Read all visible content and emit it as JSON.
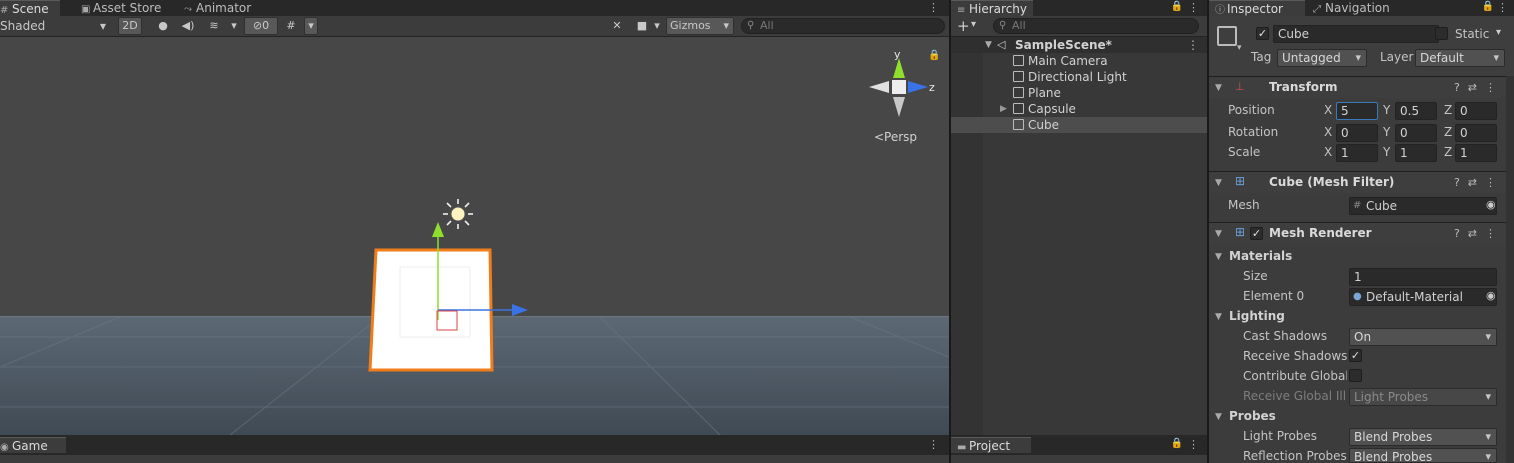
{
  "scene_panel": {
    "tabs": [
      {
        "label": "Scene",
        "icon": "grid-icon"
      },
      {
        "label": "Asset Store",
        "icon": "bag-icon"
      },
      {
        "label": "Animator",
        "icon": "animator-icon"
      }
    ],
    "toolbar": {
      "shading_mode": "Shaded",
      "mode_2d": "2D",
      "hidden_count": "0",
      "gizmos": "Gizmos",
      "search_placeholder": "All"
    },
    "viewport": {
      "persp_label": "Persp",
      "axis_y": "y",
      "axis_z": "z"
    }
  },
  "hierarchy": {
    "tab_label": "Hierarchy",
    "search_placeholder": "All",
    "scene_name": "SampleScene*",
    "items": [
      "Main Camera",
      "Directional Light",
      "Plane",
      "Capsule",
      "Cube"
    ],
    "selected": "Cube"
  },
  "inspector": {
    "tabs": [
      {
        "label": "Inspector",
        "icon": "info-icon"
      },
      {
        "label": "Navigation",
        "icon": "navigation-icon"
      }
    ],
    "object_name": "Cube",
    "static_label": "Static",
    "tag_label": "Tag",
    "tag_value": "Untagged",
    "layer_label": "Layer",
    "layer_value": "Default",
    "transform": {
      "title": "Transform",
      "position_label": "Position",
      "rotation_label": "Rotation",
      "scale_label": "Scale",
      "position": {
        "x": "5",
        "y": "0.5",
        "z": "0"
      },
      "rotation": {
        "x": "0",
        "y": "0",
        "z": "0"
      },
      "scale": {
        "x": "1",
        "y": "1",
        "z": "1"
      }
    },
    "mesh_filter": {
      "title": "Cube (Mesh Filter)",
      "mesh_label": "Mesh",
      "mesh_value": "Cube"
    },
    "mesh_renderer": {
      "title": "Mesh Renderer",
      "materials_label": "Materials",
      "size_label": "Size",
      "size_value": "1",
      "element0_label": "Element 0",
      "element0_value": "Default-Material",
      "lighting_label": "Lighting",
      "cast_shadows_label": "Cast Shadows",
      "cast_shadows_value": "On",
      "receive_shadows_label": "Receive Shadows",
      "contribute_gi_label": "Contribute Global I",
      "receive_gi_label": "Receive Global Illu",
      "receive_gi_value": "Light Probes",
      "probes_label": "Probes",
      "light_probes_label": "Light Probes",
      "light_probes_value": "Blend Probes",
      "reflection_probes_label": "Reflection Probes",
      "reflection_probes_value": "Blend Probes"
    }
  },
  "bottom": {
    "game_tab": "Game",
    "project_tab": "Project"
  },
  "colors": {
    "accent_blue": "#3a79bb",
    "selection_orange": "#f07d1a",
    "axis_green": "#8ee02d",
    "axis_blue": "#3a73e6"
  }
}
